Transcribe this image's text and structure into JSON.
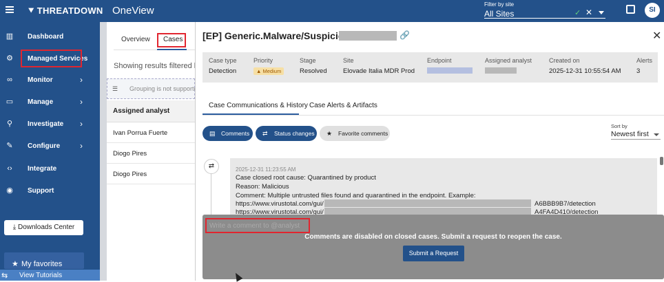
{
  "topbar": {
    "brand": "THREATDOWN",
    "app_name": "OneView",
    "filter_label": "Filter by site",
    "filter_value": "All Sites",
    "avatar": "SI"
  },
  "sidebar": {
    "items": [
      {
        "label": "Dashboard",
        "icon": "chart-icon"
      },
      {
        "label": "Managed Services",
        "icon": "managed-services-icon"
      },
      {
        "label": "Monitor",
        "icon": "binoculars-icon"
      },
      {
        "label": "Manage",
        "icon": "laptop-icon"
      },
      {
        "label": "Investigate",
        "icon": "search-icon"
      },
      {
        "label": "Configure",
        "icon": "wrench-icon"
      },
      {
        "label": "Integrate",
        "icon": "code-icon"
      },
      {
        "label": "Support",
        "icon": "chat-icon"
      }
    ],
    "downloads": "Downloads Center",
    "favorites": "My favorites",
    "tutorials": "View Tutorials"
  },
  "cases_list": {
    "tabs": [
      "Overview",
      "Cases"
    ],
    "results_text": "Showing results filtered by",
    "grouping_text": "Grouping is not supported",
    "column_header": "Assigned analyst",
    "rows": [
      "Ivan Porrua Fuerte",
      "Diogo Pires",
      "Diogo Pires"
    ]
  },
  "case": {
    "title": "[EP] Generic.Malware/Suspicious :",
    "meta": [
      {
        "key": "Case type",
        "value": "Detection"
      },
      {
        "key": "Priority",
        "value": "Medium"
      },
      {
        "key": "Stage",
        "value": "Resolved"
      },
      {
        "key": "Site",
        "value": "Elovade Italia MDR Prod"
      },
      {
        "key": "Endpoint",
        "value": ""
      },
      {
        "key": "Assigned analyst",
        "value": ""
      },
      {
        "key": "Created on",
        "value": "2025-12-31 10:55:54 AM"
      },
      {
        "key": "Alerts",
        "value": "3"
      }
    ],
    "tabs": [
      "Case Communications & History",
      "Case Alerts & Artifacts"
    ],
    "filters": [
      "Comments",
      "Status changes",
      "Favorite comments"
    ],
    "sort_label": "Sort by",
    "sort_value": "Newest first",
    "message": {
      "timestamp": "2025-12-31 11:23:55 AM",
      "line1": "Case closed root cause: Quarantined by product",
      "line2": "Reason: Malicious",
      "line3": "Comment: Multiple untrusted files found and quarantined in the endpoint. Example:",
      "url1_prefix": "https://www.virustotal.com/gui/",
      "url1_suffix": "A6BBB9B7/detection",
      "url2_prefix": "https://www.virustotal.com/gui/",
      "url2_suffix": "A4FA4D410/detection"
    },
    "comment_placeholder": "Write a comment to @analyst",
    "disabled_notice": "Comments are disabled on closed cases. Submit a request to reopen the case.",
    "submit_button": "Submit a Request"
  }
}
